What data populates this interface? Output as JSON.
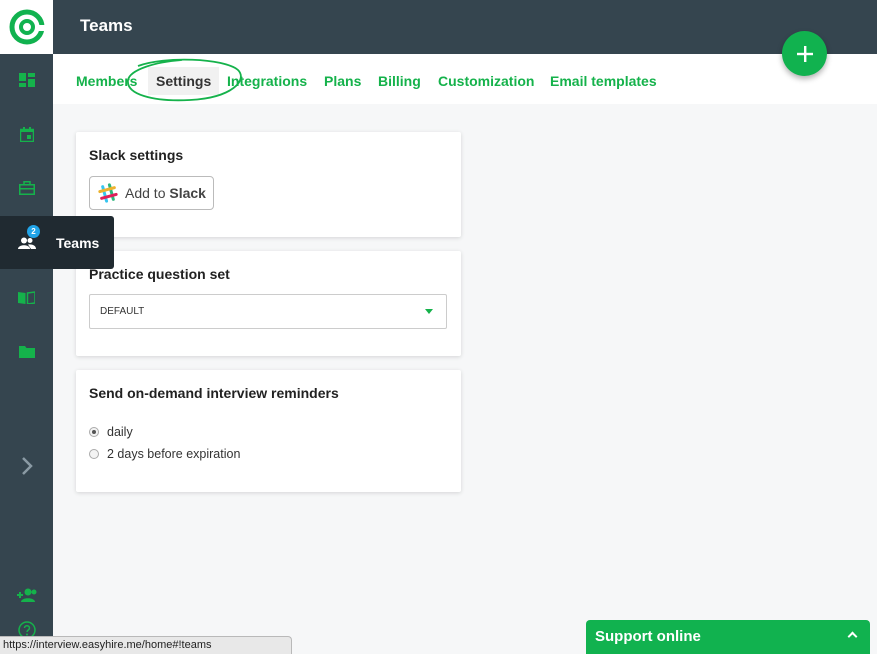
{
  "header": {
    "title": "Teams"
  },
  "sidebar": {
    "active_item": {
      "label": "Teams",
      "badge": "2"
    }
  },
  "tabs": [
    {
      "label": "Members"
    },
    {
      "label": "Settings"
    },
    {
      "label": "Integrations"
    },
    {
      "label": "Plans"
    },
    {
      "label": "Billing"
    },
    {
      "label": "Customization"
    },
    {
      "label": "Email templates"
    }
  ],
  "slack_card": {
    "title": "Slack settings",
    "button_prefix": "Add to ",
    "button_brand": "Slack"
  },
  "question_card": {
    "title": "Practice question set",
    "selected": "DEFAULT"
  },
  "reminder_card": {
    "title": "Send on-demand interview reminders",
    "options": [
      {
        "label": "daily",
        "checked": true
      },
      {
        "label": "2 days before expiration",
        "checked": false
      }
    ]
  },
  "status_url": "https://interview.easyhire.me/home#!teams",
  "support": {
    "label": "Support online"
  },
  "colors": {
    "accent": "#15b24b",
    "sidebar": "#35454f",
    "badge": "#21a4e8"
  }
}
